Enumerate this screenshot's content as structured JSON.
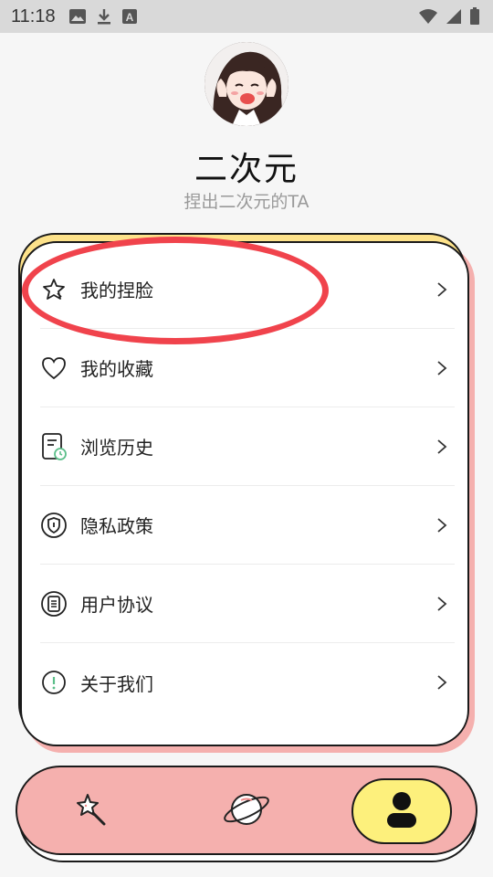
{
  "status_bar": {
    "time": "11:18",
    "left_icons": [
      "image-icon",
      "download-icon",
      "a-badge-icon"
    ],
    "right_icons": [
      "wifi-icon",
      "signal-icon",
      "battery-icon"
    ]
  },
  "profile": {
    "name": "二次元",
    "subtitle": "捏出二次元的TA",
    "avatar": "avatar-anime-girl"
  },
  "menu": {
    "items": [
      {
        "label": "我的捏脸",
        "icon": "star-icon"
      },
      {
        "label": "我的收藏",
        "icon": "heart-icon"
      },
      {
        "label": "浏览历史",
        "icon": "history-document-icon"
      },
      {
        "label": "隐私政策",
        "icon": "shield-icon"
      },
      {
        "label": "用户协议",
        "icon": "agreement-list-icon"
      },
      {
        "label": "关于我们",
        "icon": "info-icon"
      }
    ]
  },
  "bottom_nav": {
    "tabs": [
      {
        "name": "create",
        "icon": "magic-wand-star-icon",
        "active": false
      },
      {
        "name": "explore",
        "icon": "planet-icon",
        "active": false
      },
      {
        "name": "profile",
        "icon": "user-icon",
        "active": true
      }
    ]
  },
  "colors": {
    "card_yellow": "#fde28a",
    "card_pink": "#f5b0ae",
    "nav_active": "#fdf07c",
    "highlight_red": "#f0434c"
  }
}
